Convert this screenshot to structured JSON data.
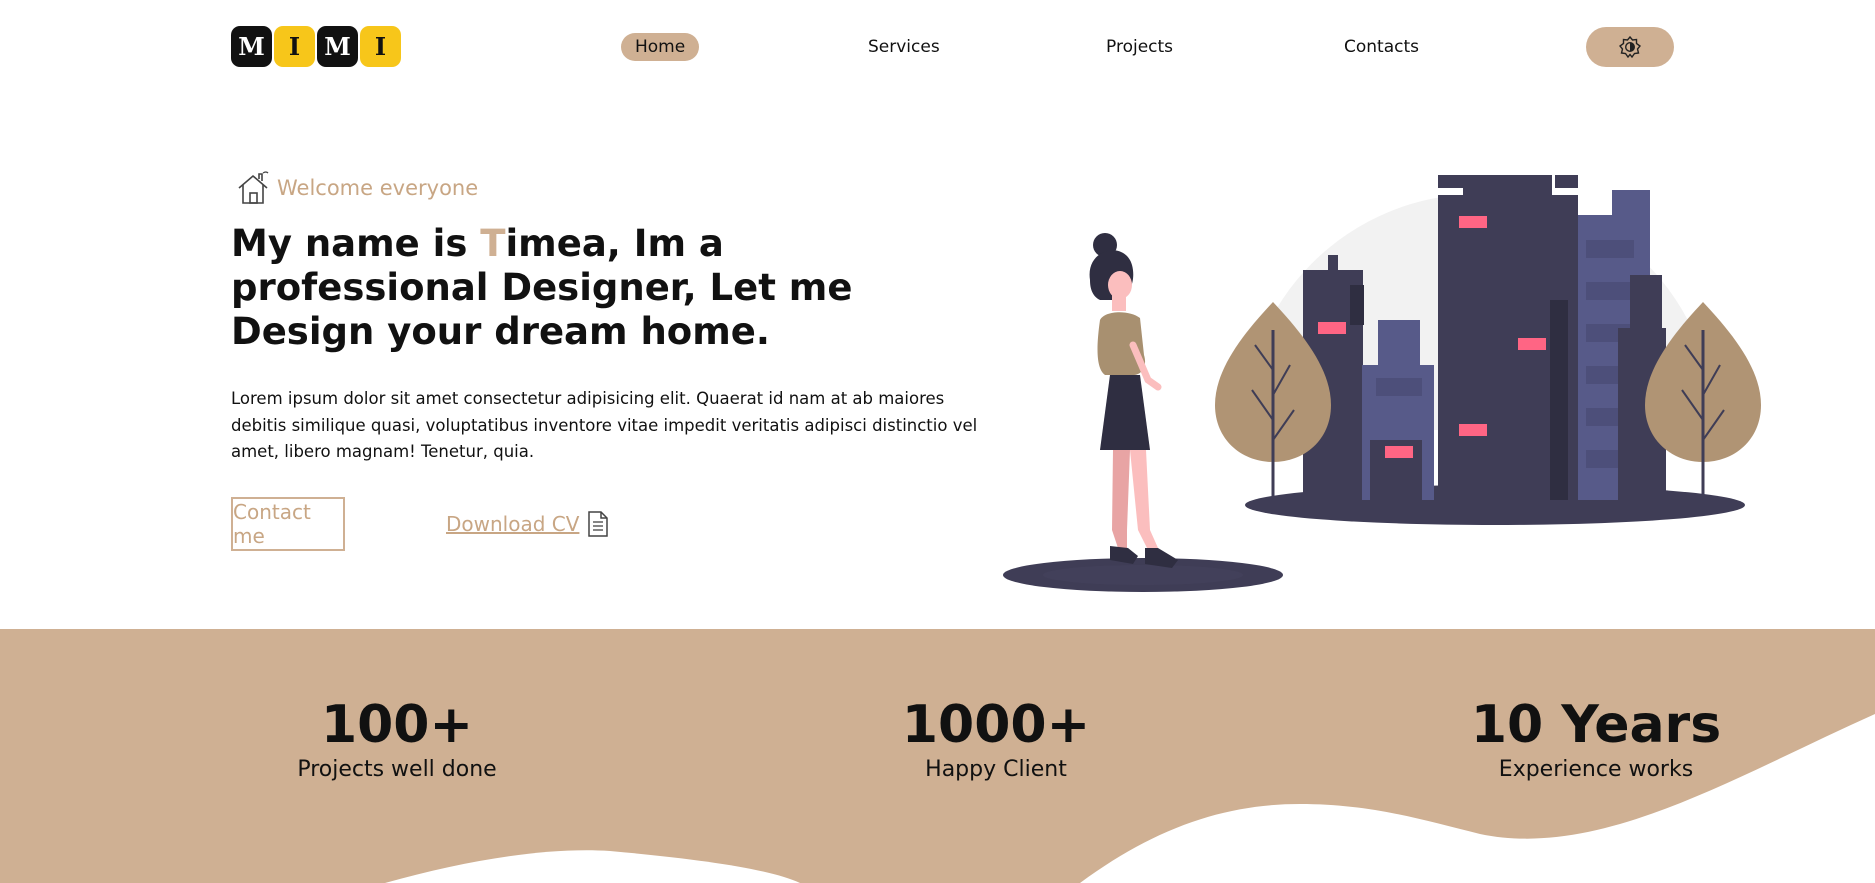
{
  "logo": {
    "letters": [
      "M",
      "I",
      "M",
      "I"
    ]
  },
  "nav": {
    "items": [
      {
        "label": "Home",
        "active": true
      },
      {
        "label": "Services",
        "active": false
      },
      {
        "label": "Projects",
        "active": false
      },
      {
        "label": "Contacts",
        "active": false
      }
    ],
    "theme_toggle_icon": "brightness-icon"
  },
  "hero": {
    "welcome": "Welcome everyone",
    "headline_pre": "My name is ",
    "headline_accent": "T",
    "headline_post": "imea, Im a professional Designer, Let me Design your dream home.",
    "intro": "Lorem ipsum dolor sit amet consectetur adipisicing elit. Quaerat id nam at ab maiores debitis similique quasi, voluptatibus inventore vitae impedit veritatis adipisci distinctio vel amet, libero magnam! Tenetur, quia.",
    "contact_label": "Contact me",
    "download_label": "Download CV"
  },
  "stats": [
    {
      "value": "100+",
      "label": "Projects well done"
    },
    {
      "value": "1000+",
      "label": "Happy Client"
    },
    {
      "value": "10 Years",
      "label": "Experience works"
    }
  ],
  "colors": {
    "accent": "#cfb093",
    "logo_yellow": "#f7c61a",
    "dark": "#111111",
    "building_dark": "#3f3d56",
    "building_purple": "#575a89",
    "window_pink": "#ff6584"
  }
}
